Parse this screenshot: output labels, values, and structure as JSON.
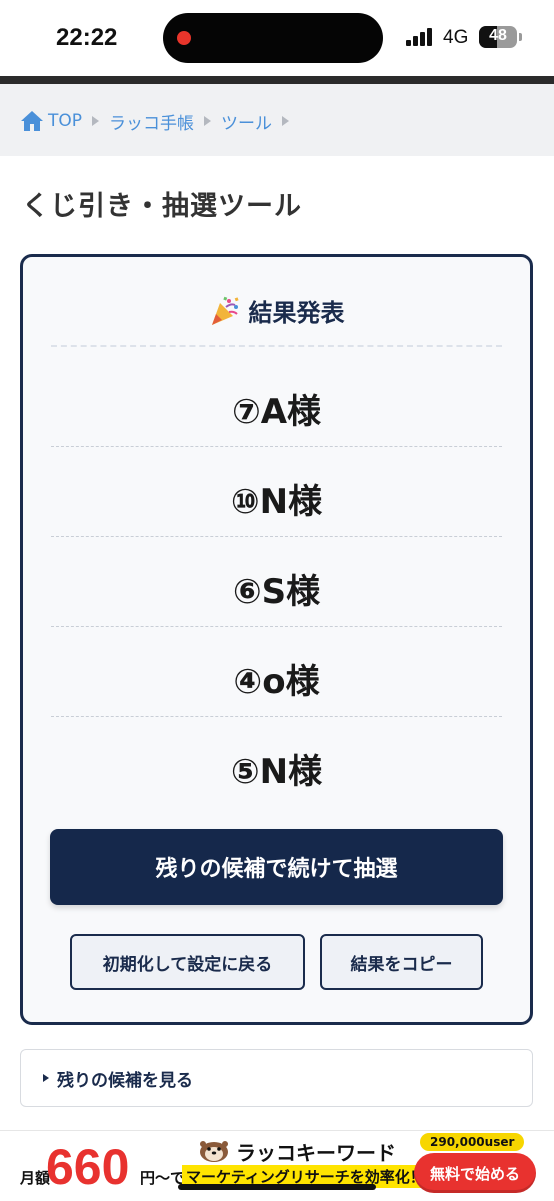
{
  "status_bar": {
    "time": "22:22",
    "network": "4G",
    "battery": "48",
    "battery_level": 0.48
  },
  "breadcrumb": {
    "items": [
      "TOP",
      "ラッコ手帳",
      "ツール"
    ]
  },
  "page": {
    "title": "くじ引き・抽選ツール"
  },
  "result_card": {
    "heading": "結果発表",
    "results": [
      "⑦A様",
      "⑩N様",
      "⑥S様",
      "④o様",
      "⑤N様"
    ],
    "continue_label": "残りの候補で続けて抽選",
    "reset_label": "初期化して設定に戻る",
    "copy_label": "結果をコピー"
  },
  "remaining": {
    "label": "残りの候補を見る"
  },
  "ad": {
    "monthly_label": "月額",
    "price": "660",
    "yen_label": "円〜で",
    "brand": "ラッコキーワード",
    "tagline": "マーケティングリサーチを効率化！",
    "users": "290,000user",
    "cta": "無料で始める"
  },
  "colors": {
    "navy": "#15284b",
    "link_blue": "#4a90d9",
    "ad_red": "#e8322f",
    "ad_yellow": "#ffe400"
  }
}
